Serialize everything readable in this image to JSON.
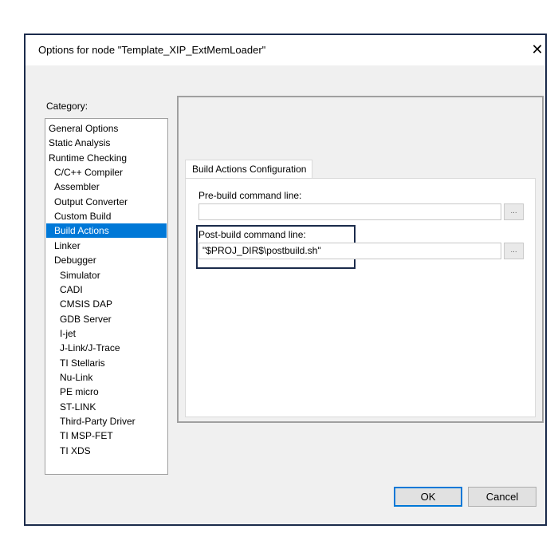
{
  "dialog": {
    "title": "Options for node \"Template_XIP_ExtMemLoader\"",
    "close_icon": "close-icon"
  },
  "category": {
    "label": "Category:",
    "items": [
      {
        "label": "General Options",
        "level": 0
      },
      {
        "label": "Static Analysis",
        "level": 0
      },
      {
        "label": "Runtime Checking",
        "level": 0
      },
      {
        "label": "C/C++ Compiler",
        "level": 1
      },
      {
        "label": "Assembler",
        "level": 1
      },
      {
        "label": "Output Converter",
        "level": 1
      },
      {
        "label": "Custom Build",
        "level": 1
      },
      {
        "label": "Build Actions",
        "level": 1,
        "selected": true
      },
      {
        "label": "Linker",
        "level": 1
      },
      {
        "label": "Debugger",
        "level": 1
      },
      {
        "label": "Simulator",
        "level": 2
      },
      {
        "label": "CADI",
        "level": 2
      },
      {
        "label": "CMSIS DAP",
        "level": 2
      },
      {
        "label": "GDB Server",
        "level": 2
      },
      {
        "label": "I-jet",
        "level": 2
      },
      {
        "label": "J-Link/J-Trace",
        "level": 2
      },
      {
        "label": "TI Stellaris",
        "level": 2
      },
      {
        "label": "Nu-Link",
        "level": 2
      },
      {
        "label": "PE micro",
        "level": 2
      },
      {
        "label": "ST-LINK",
        "level": 2
      },
      {
        "label": "Third-Party Driver",
        "level": 2
      },
      {
        "label": "TI MSP-FET",
        "level": 2
      },
      {
        "label": "TI XDS",
        "level": 2
      }
    ]
  },
  "tab": {
    "label": "Build Actions Configuration"
  },
  "prebuild": {
    "label": "Pre-build command line:",
    "value": "",
    "browse": "..."
  },
  "postbuild": {
    "label": "Post-build command line:",
    "value": "\"$PROJ_DIR$\\postbuild.sh\"",
    "browse": "..."
  },
  "buttons": {
    "ok": "OK",
    "cancel": "Cancel"
  },
  "colors": {
    "selection": "#0078d7",
    "highlight_border": "#1b2b4b"
  }
}
